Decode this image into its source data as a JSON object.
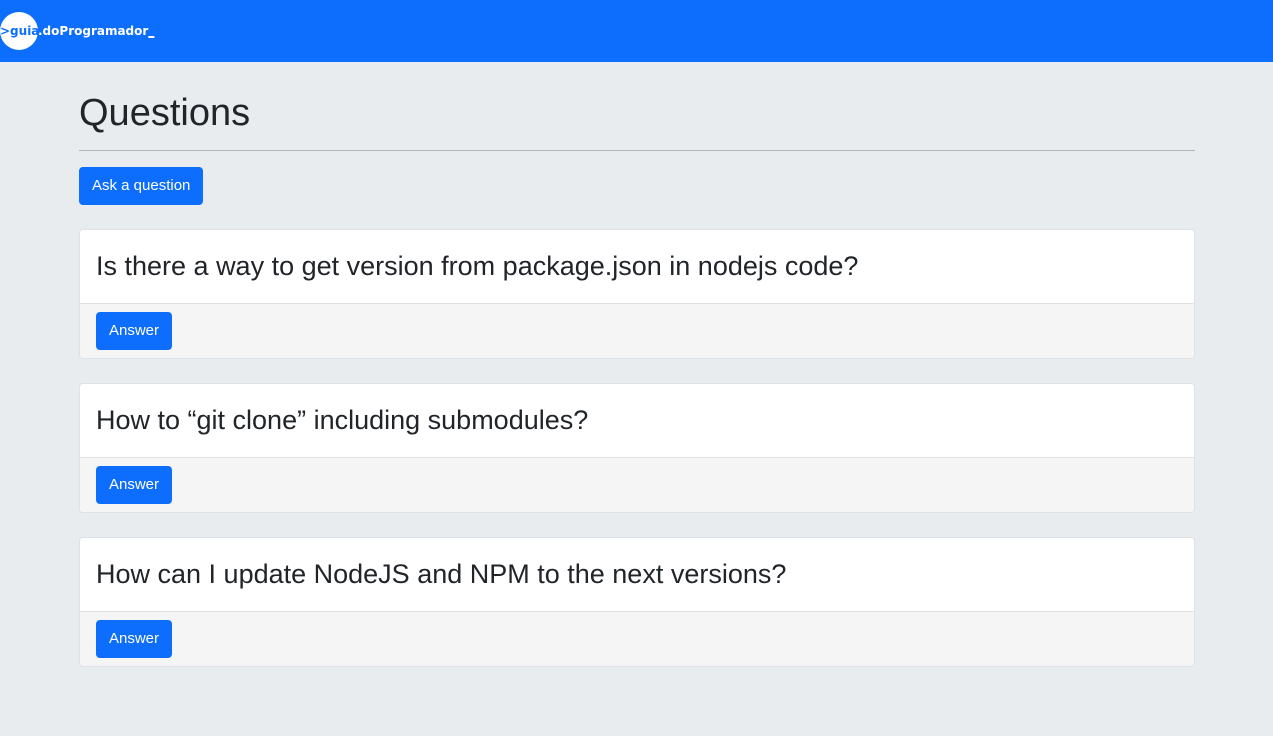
{
  "navbar": {
    "brand_prefix": ">guia",
    "brand_rest": ".doProgramador",
    "brand_cursor": "_"
  },
  "page": {
    "title": "Questions",
    "ask_button": "Ask a question"
  },
  "questions": [
    {
      "title": "Is there a way to get version from package.json in nodejs code?",
      "answer_label": "Answer"
    },
    {
      "title": "How to “git clone” including submodules?",
      "answer_label": "Answer"
    },
    {
      "title": "How can I update NodeJS and NPM to the next versions?",
      "answer_label": "Answer"
    }
  ],
  "colors": {
    "primary": "#0d6efd",
    "background": "#e9ecef",
    "card_footer": "#f5f5f5"
  }
}
